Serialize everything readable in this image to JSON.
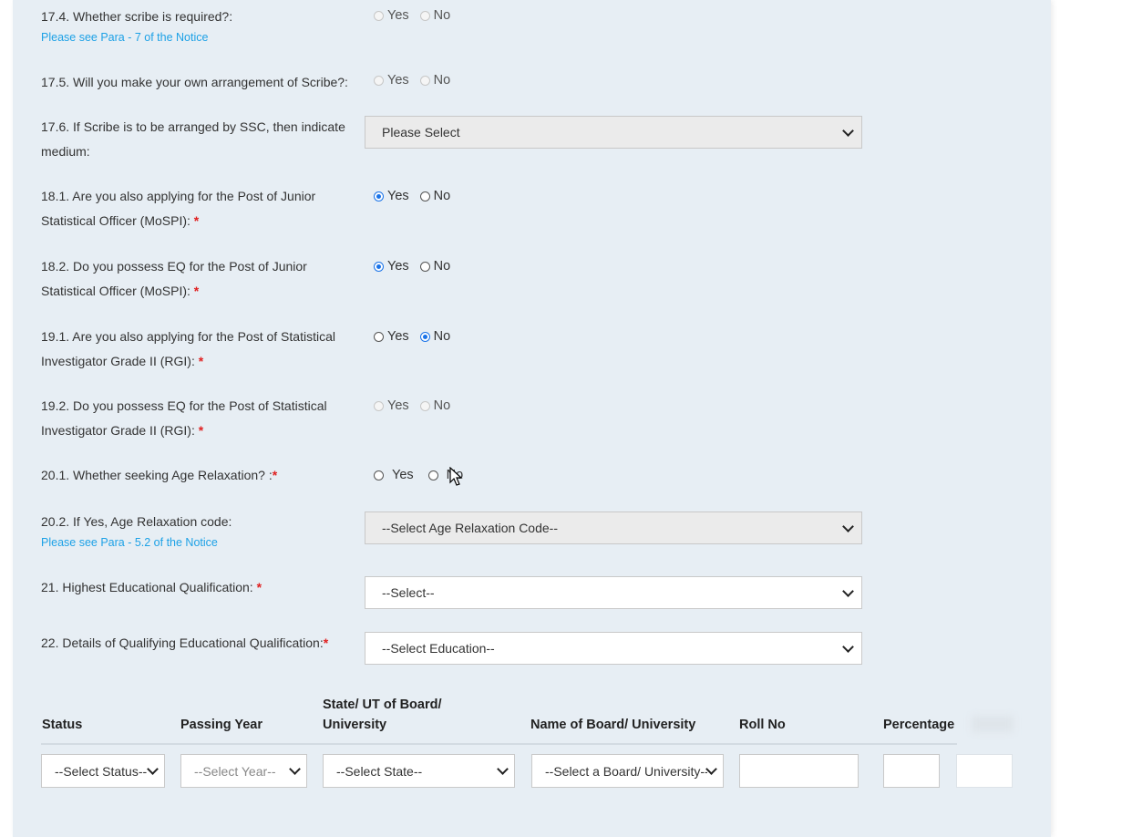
{
  "q17_4": {
    "label": "17.4. Whether scribe is required?:",
    "note": "Please see Para - 7 of the Notice",
    "yes": "Yes",
    "no": "No"
  },
  "q17_5": {
    "label": "17.5. Will you make your own arrangement of Scribe?:",
    "yes": "Yes",
    "no": "No"
  },
  "q17_6": {
    "label_line1": "17.6. If Scribe is to be arranged by SSC, then indicate",
    "label_line2": "medium:",
    "select": "Please Select"
  },
  "q18_1": {
    "label_line1": "18.1. Are you also applying for the Post of Junior",
    "label_line2": "Statistical Officer (MoSPI):",
    "yes": "Yes",
    "no": "No"
  },
  "q18_2": {
    "label_line1": "18.2. Do you possess EQ for the Post of Junior",
    "label_line2": "Statistical Officer (MoSPI):",
    "yes": "Yes",
    "no": "No"
  },
  "q19_1": {
    "label_line1": "19.1. Are you also applying for the Post of Statistical",
    "label_line2": "Investigator Grade II (RGI):",
    "yes": "Yes",
    "no": "No"
  },
  "q19_2": {
    "label_line1": "19.2. Do you possess EQ for the Post of Statistical",
    "label_line2": "Investigator Grade II (RGI):",
    "yes": "Yes",
    "no": "No"
  },
  "q20_1": {
    "label": "20.1. Whether seeking Age Relaxation? :",
    "yes": "Yes",
    "no": "No"
  },
  "q20_2": {
    "label": "20.2. If Yes, Age Relaxation code:",
    "note": "Please see Para - 5.2 of the Notice",
    "select": "--Select Age Relaxation Code--"
  },
  "q21": {
    "label": "21. Highest Educational Qualification:",
    "select": "--Select--"
  },
  "q22": {
    "label": "22. Details of Qualifying Educational Qualification:",
    "select": "--Select Education--"
  },
  "required_mark": "*",
  "table": {
    "headers": {
      "status": "Status",
      "passing_year": "Passing Year",
      "state_line1": "State/ UT of Board/",
      "state_line2": "University",
      "board": "Name of Board/ University",
      "roll": "Roll No",
      "percentage": "Percentage"
    },
    "row": {
      "status": "--Select Status--",
      "year": "--Select Year--",
      "state": "--Select State--",
      "board": "--Select a Board/ University--"
    }
  },
  "colors": {
    "accent": "#1a73e8",
    "note": "#1da1e6",
    "required": "#e02020",
    "panel": "#e7eef4"
  }
}
